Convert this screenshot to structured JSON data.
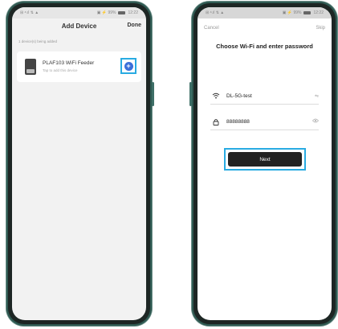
{
  "left_phone": {
    "status_left": "⊞ ᵃ.ıl ⇅ ▲",
    "status_right": "▣ ⚡ 99%",
    "status_time": "12:22",
    "title": "Add Device",
    "done_label": "Done",
    "found_text": "1 device(s) being added",
    "device": {
      "name": "PLAF103 WiFi Feeder",
      "subtitle": "Tap to add this device",
      "add_icon": "plus-circle-icon"
    }
  },
  "right_phone": {
    "status_left": "⊞ ᵃ.ıl ⇅ ▲",
    "status_right": "▣ ⚡ 99%",
    "status_time": "12:22",
    "cancel_label": "Cancel",
    "skip_label": "Skip",
    "heading": "Choose Wi-Fi and enter password",
    "wifi_icon": "wifi-icon",
    "wifi_name": "DL-5G-test",
    "wifi_switch_icon": "⇋",
    "lock_icon": "lock-icon",
    "password": "88888888",
    "eye_icon": "eye-icon",
    "next_label": "Next"
  },
  "colors": {
    "highlight": "#29abe2",
    "phone_frame": "#1d2624",
    "add_button": "#3b6fd9",
    "next_button": "#222222"
  }
}
